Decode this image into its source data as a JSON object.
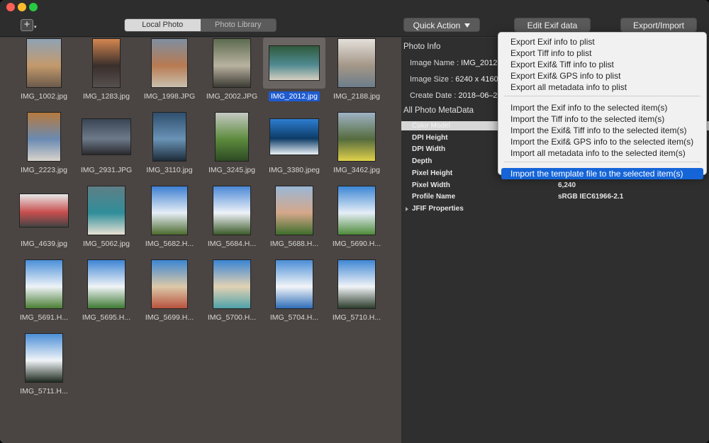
{
  "toolbar": {
    "add_symbol": "+",
    "add_menu_caret": "▾",
    "tabs": [
      {
        "label": "Local Photo",
        "active": true
      },
      {
        "label": "Photo Library",
        "active": false
      }
    ],
    "quick_action_label": "Quick Action",
    "edit_exif_label": "Edit Exif data",
    "export_import_label": "Export/Import"
  },
  "photos": [
    {
      "name": "IMG_1002.jpg",
      "palette": [
        "#8fa2b5",
        "#c49a6c",
        "#6b5a4a"
      ]
    },
    {
      "name": "IMG_1283.jpg",
      "palette": [
        "#d48650",
        "#3a2f2b",
        "#55504f"
      ]
    },
    {
      "name": "IMG_1998.JPG",
      "palette": [
        "#7e8fa0",
        "#b87a52",
        "#c9c0ae"
      ]
    },
    {
      "name": "IMG_2002.JPG",
      "palette": [
        "#5c6b4f",
        "#b9b2a0",
        "#3c3a33"
      ]
    },
    {
      "name": "IMG_2012.jpg",
      "palette": [
        "#2f5a3b",
        "#4f8a91",
        "#d5cfc0"
      ],
      "selected": true
    },
    {
      "name": "IMG_2188.jpg",
      "palette": [
        "#e4e0da",
        "#a49788",
        "#6c7d8a"
      ]
    },
    {
      "name": "IMG_2223.jpg",
      "palette": [
        "#b67a3f",
        "#6a8ab2",
        "#d9d4cc"
      ]
    },
    {
      "name": "IMG_2931.JPG",
      "palette": [
        "#3a4454",
        "#6d7a8a",
        "#2a2a2e"
      ]
    },
    {
      "name": "IMG_3110.jpg",
      "palette": [
        "#2f4f6e",
        "#6a93b6",
        "#1c2b38"
      ]
    },
    {
      "name": "IMG_3245.jpg",
      "palette": [
        "#c5c9c3",
        "#5d8b3d",
        "#2d4a24"
      ]
    },
    {
      "name": "IMG_3380.jpeg",
      "palette": [
        "#2d7dd2",
        "#0d3b66",
        "#e9f1f7"
      ]
    },
    {
      "name": "IMG_3462.jpg",
      "palette": [
        "#9fb3c4",
        "#556b3e",
        "#e0d24a"
      ]
    },
    {
      "name": "IMG_4639.jpg",
      "palette": [
        "#e8e8e8",
        "#c84f4f",
        "#444444"
      ]
    },
    {
      "name": "IMG_5062.jpg",
      "palette": [
        "#5f7f86",
        "#2f8e9a",
        "#e8e2d4"
      ]
    },
    {
      "name": "IMG_5682.H...",
      "palette": [
        "#3d7fd1",
        "#e6eef6",
        "#4d6b2e"
      ]
    },
    {
      "name": "IMG_5684.H...",
      "palette": [
        "#4b88d6",
        "#eef3f8",
        "#3c5a28"
      ]
    },
    {
      "name": "IMG_5688.H...",
      "palette": [
        "#9bb8d6",
        "#d5a78a",
        "#3f6e2b"
      ]
    },
    {
      "name": "IMG_5690.H...",
      "palette": [
        "#3c86d5",
        "#e5eef6",
        "#4e8a3a"
      ]
    },
    {
      "name": "IMG_5691.H...",
      "palette": [
        "#4a8fd8",
        "#eef3f8",
        "#4b7f34"
      ]
    },
    {
      "name": "IMG_5695.H...",
      "palette": [
        "#3e85d4",
        "#f0f4f7",
        "#3f7a33"
      ]
    },
    {
      "name": "IMG_5699.H...",
      "palette": [
        "#3c86d2",
        "#dcc9a8",
        "#b8523e"
      ]
    },
    {
      "name": "IMG_5700.H...",
      "palette": [
        "#3a84d3",
        "#e2d2b4",
        "#4fa1a9"
      ]
    },
    {
      "name": "IMG_5704.H...",
      "palette": [
        "#4a8ed6",
        "#f2f5f8",
        "#2f6db8"
      ]
    },
    {
      "name": "IMG_5710.H...",
      "palette": [
        "#3f87d4",
        "#f1f4f7",
        "#2b3c2a"
      ]
    },
    {
      "name": "IMG_5711.H...",
      "palette": [
        "#4c8fd6",
        "#f0f4f8",
        "#1f2a1e"
      ]
    }
  ],
  "photo_info": {
    "section_title": "Photo Info",
    "image_name_label": "Image Name :",
    "image_name_value": "IMG_2012.jpg",
    "image_size_label": "Image Size :",
    "image_size_value": "6240 x 4160",
    "create_date_label": "Create Date :",
    "create_date_value": "2018–06–25"
  },
  "metadata": {
    "section_title": "All Photo MetaData",
    "rows": [
      {
        "key": "Color Model",
        "value": ""
      },
      {
        "key": "DPI Height",
        "value": ""
      },
      {
        "key": "DPI Width",
        "value": ""
      },
      {
        "key": "Depth",
        "value": ""
      },
      {
        "key": "Pixel Height",
        "value": ""
      },
      {
        "key": "Pixel Width",
        "value": "6,240"
      },
      {
        "key": "Profile Name",
        "value": "sRGB IEC61966-2.1"
      },
      {
        "key": "JFIF Properties",
        "value": ""
      }
    ]
  },
  "export_menu": {
    "group_export": [
      "Export Exif info to plist",
      "Export Tiff info to plist",
      "Export Exif& Tiff info to plist",
      "Export Exif& GPS info to plist",
      "Export all metadata info to plist"
    ],
    "group_import": [
      "Import the Exif info to the selected item(s)",
      "Import the Tiff info to the selected item(s)",
      "Import the Exif& Tiff info to the selected item(s)",
      "Import the Exif& GPS info to the selected item(s)",
      "Import all metadata info to the selected item(s)"
    ],
    "group_template": [
      "Import the template file to the selected item(s)"
    ]
  },
  "colors": {
    "accent": "#1565d8",
    "selection_label": "#1e5bd0",
    "left_pane_bg": "#4a4542",
    "right_pane_bg": "#2f2f2f"
  }
}
